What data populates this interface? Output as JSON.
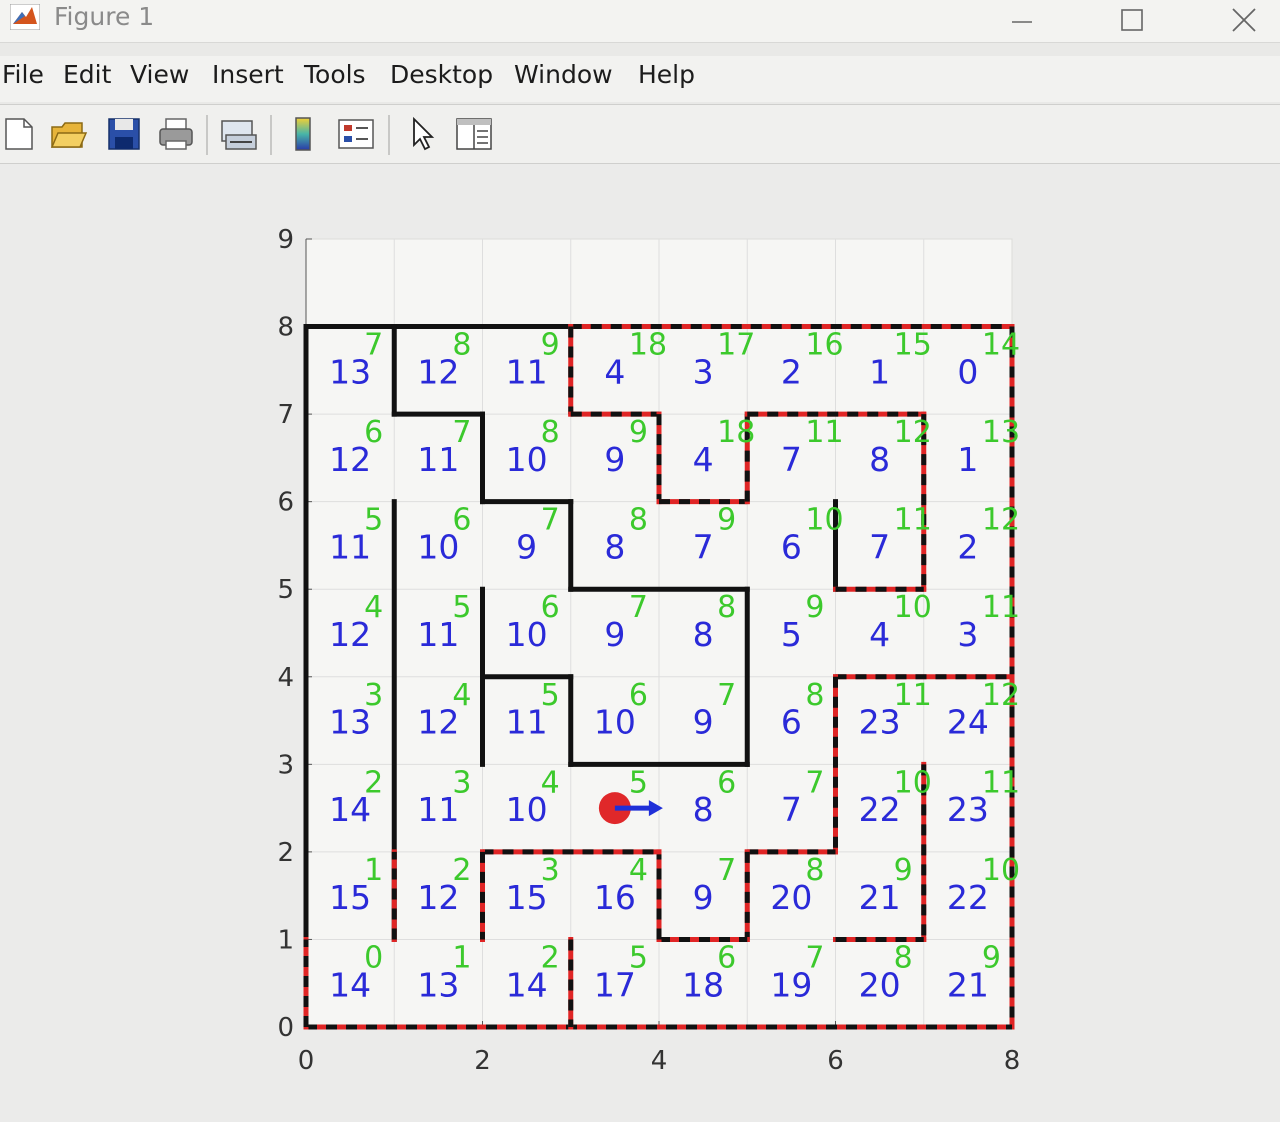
{
  "window": {
    "title": "Figure 1",
    "controls": [
      "minimize",
      "maximize",
      "close"
    ]
  },
  "menu": [
    "File",
    "Edit",
    "View",
    "Insert",
    "Tools",
    "Desktop",
    "Window",
    "Help"
  ],
  "toolbar": {
    "buttons": [
      "new-figure",
      "open-file",
      "save",
      "print",
      "link-plot",
      "colorbar",
      "legend",
      "edit-plot",
      "property-inspector"
    ]
  },
  "colors": {
    "cell_value": "#2a2ad8",
    "cell_step": "#3cc92c",
    "wall": "#111111",
    "path": "#e02525",
    "robot": "#e0282a",
    "robot_arrow": "#1f2fd8"
  },
  "chart_data": {
    "type": "heatmap",
    "title": "",
    "xlabel": "",
    "ylabel": "",
    "xlim": [
      0,
      8
    ],
    "ylim": [
      0,
      9
    ],
    "xticks": [
      "0",
      "2",
      "4",
      "6",
      "8"
    ],
    "yticks": [
      "0",
      "1",
      "2",
      "3",
      "4",
      "5",
      "6",
      "7",
      "8",
      "9"
    ],
    "grid": true,
    "cells_note": "rows listed top (y 7-8) to bottom (y 0-1); columns x 0-1 ... 7-8; null = empty cell",
    "cell_values": [
      [
        13,
        12,
        11,
        4,
        3,
        2,
        1,
        0
      ],
      [
        12,
        11,
        10,
        9,
        4,
        7,
        8,
        1
      ],
      [
        11,
        10,
        9,
        8,
        7,
        6,
        7,
        2
      ],
      [
        12,
        11,
        10,
        9,
        8,
        5,
        4,
        3
      ],
      [
        13,
        12,
        11,
        10,
        9,
        6,
        23,
        24
      ],
      [
        14,
        11,
        10,
        null,
        8,
        7,
        22,
        23
      ],
      [
        15,
        12,
        15,
        16,
        9,
        20,
        21,
        22
      ],
      [
        14,
        13,
        14,
        17,
        18,
        19,
        20,
        21
      ]
    ],
    "cell_steps": [
      [
        7,
        8,
        9,
        18,
        17,
        16,
        15,
        14
      ],
      [
        6,
        7,
        8,
        9,
        18,
        11,
        12,
        13
      ],
      [
        5,
        6,
        7,
        8,
        9,
        10,
        11,
        12
      ],
      [
        4,
        5,
        6,
        7,
        8,
        9,
        10,
        11
      ],
      [
        3,
        4,
        5,
        6,
        7,
        8,
        11,
        12
      ],
      [
        2,
        3,
        4,
        5,
        6,
        7,
        10,
        11
      ],
      [
        1,
        2,
        3,
        4,
        7,
        8,
        9,
        10
      ],
      [
        0,
        1,
        2,
        5,
        6,
        7,
        8,
        9
      ]
    ],
    "solid_walls": [
      [
        [
          0,
          0
        ],
        [
          0,
          8
        ]
      ],
      [
        [
          0,
          8
        ],
        [
          3,
          8
        ]
      ],
      [
        [
          1,
          8
        ],
        [
          1,
          7
        ]
      ],
      [
        [
          1,
          7
        ],
        [
          2,
          7
        ]
      ],
      [
        [
          2,
          7
        ],
        [
          2,
          6
        ]
      ],
      [
        [
          2,
          6
        ],
        [
          3,
          6
        ]
      ],
      [
        [
          3,
          6
        ],
        [
          3,
          5
        ]
      ],
      [
        [
          3,
          5
        ],
        [
          5,
          5
        ]
      ],
      [
        [
          5,
          5
        ],
        [
          5,
          3
        ]
      ],
      [
        [
          3,
          3
        ],
        [
          5,
          3
        ]
      ],
      [
        [
          3,
          3
        ],
        [
          3,
          4
        ]
      ],
      [
        [
          2,
          4
        ],
        [
          3,
          4
        ]
      ],
      [
        [
          2,
          5
        ],
        [
          2,
          3
        ]
      ],
      [
        [
          1,
          6
        ],
        [
          1,
          1
        ]
      ],
      [
        [
          6,
          6
        ],
        [
          6,
          5
        ]
      ]
    ],
    "dashed_walls": [
      [
        [
          3,
          8
        ],
        [
          8,
          8
        ]
      ],
      [
        [
          8,
          8
        ],
        [
          8,
          0
        ]
      ],
      [
        [
          0,
          0
        ],
        [
          8,
          0
        ]
      ],
      [
        [
          3,
          8
        ],
        [
          3,
          7
        ]
      ],
      [
        [
          3,
          7
        ],
        [
          4,
          7
        ]
      ],
      [
        [
          4,
          7
        ],
        [
          4,
          6
        ]
      ],
      [
        [
          4,
          6
        ],
        [
          5,
          6
        ]
      ],
      [
        [
          5,
          6
        ],
        [
          5,
          7
        ]
      ],
      [
        [
          5,
          7
        ],
        [
          7,
          7
        ]
      ],
      [
        [
          7,
          7
        ],
        [
          7,
          5
        ]
      ],
      [
        [
          6,
          5
        ],
        [
          7,
          5
        ]
      ],
      [
        [
          6,
          4
        ],
        [
          8,
          4
        ]
      ],
      [
        [
          6,
          4
        ],
        [
          6,
          2
        ]
      ],
      [
        [
          5,
          2
        ],
        [
          6,
          2
        ]
      ],
      [
        [
          5,
          2
        ],
        [
          5,
          1
        ]
      ],
      [
        [
          4,
          1
        ],
        [
          5,
          1
        ]
      ],
      [
        [
          4,
          1
        ],
        [
          4,
          2
        ]
      ],
      [
        [
          2,
          2
        ],
        [
          4,
          2
        ]
      ],
      [
        [
          2,
          2
        ],
        [
          2,
          1
        ]
      ],
      [
        [
          7,
          3
        ],
        [
          7,
          1
        ]
      ],
      [
        [
          6,
          1
        ],
        [
          7,
          1
        ]
      ],
      [
        [
          1,
          1
        ],
        [
          1,
          2
        ]
      ],
      [
        [
          3,
          1
        ],
        [
          3,
          0
        ]
      ],
      [
        [
          0,
          0
        ],
        [
          0,
          1
        ]
      ]
    ],
    "robot": {
      "x": 3.5,
      "y": 2.5,
      "heading": "east"
    }
  }
}
